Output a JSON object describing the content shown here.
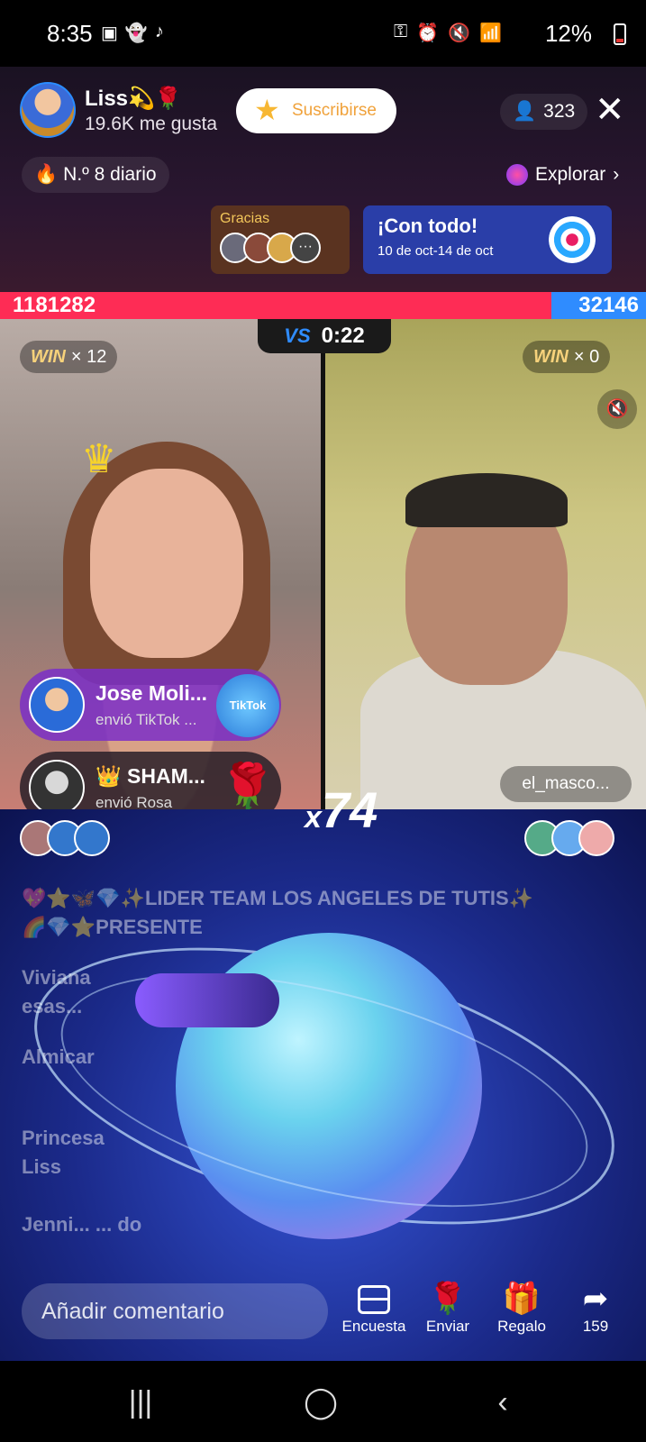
{
  "status_bar": {
    "time": "8:35",
    "battery": "12%",
    "left_icons": [
      "gallery-icon",
      "snapchat-icon",
      "tiktok-icon"
    ],
    "right_icons": [
      "battery-saver-icon",
      "alarm-icon",
      "mute-icon",
      "wifi-icon",
      "signal-icon"
    ]
  },
  "host": {
    "name": "Liss💫🌹",
    "likes": "19.6K me gusta",
    "subscribe_label": "Suscribirse",
    "viewer_count": "323",
    "rank_label": "N.º 8 diario",
    "explore_label": "Explorar"
  },
  "cards": {
    "gracias_title": "Gracias",
    "gracias_more": "···",
    "event_title": "¡Con todo!",
    "event_dates": "10 de oct-14 de oct"
  },
  "battle": {
    "score_left": "1181282",
    "score_right": "32146",
    "timer": "0:22",
    "vs_label": "VS",
    "win_label": "WIN",
    "win_left": "× 12",
    "win_right": "× 0",
    "opponent_name": "el_masco...",
    "combo_prefix": "x",
    "combo_count": "74"
  },
  "gifts": [
    {
      "user": "Jose Moli...",
      "desc": "envió TikTok ...",
      "gift_text": "TikTok LIVE"
    },
    {
      "user": "👑 SHAM...",
      "desc": "envió Rosa",
      "gift_icon": "🌹"
    }
  ],
  "chat": [
    "💖⭐🦋💎✨LIDER TEAM LOS ANGELES DE TUTIS✨",
    "🌈💎⭐PRESENTE",
    "Viviana",
    "esas...",
    "Almicar",
    "Princesa",
    "Liss",
    "Jenni... ... do"
  ],
  "bottom_bar": {
    "comment_placeholder": "Añadir comentario",
    "poll_label": "Encuesta",
    "send_label": "Enviar",
    "send_icon": "🌹",
    "gift_label": "Regalo",
    "gift_icon": "🎁",
    "share_count": "159",
    "share_icon": "➦"
  },
  "nav": {
    "recents_icon": "|||",
    "home_icon": "◯",
    "back_icon": "‹"
  },
  "colors": {
    "score_red": "#fe2c55",
    "score_blue": "#2f8cff",
    "event_blue": "#2a3ea8",
    "subscribe_text": "#f0a23b"
  }
}
